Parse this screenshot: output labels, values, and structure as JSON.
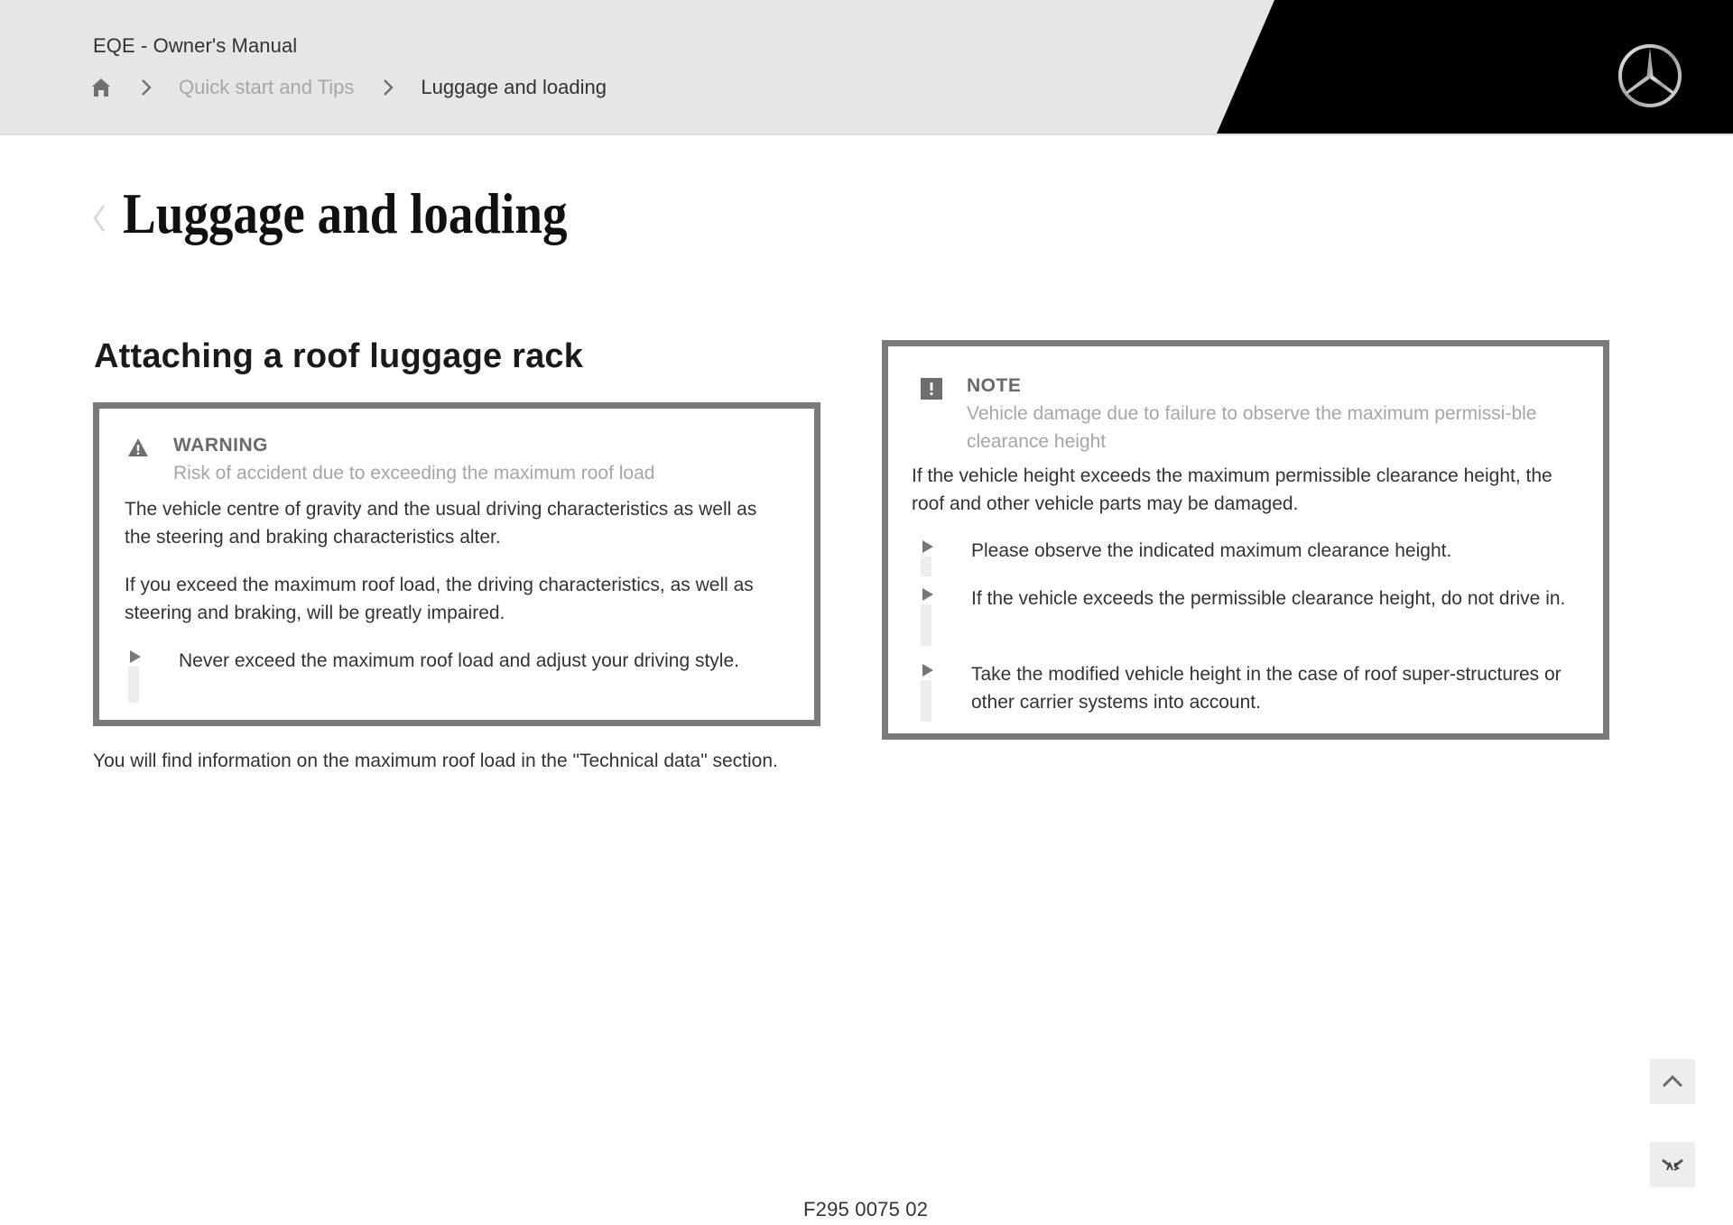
{
  "header": {
    "manual_title": "EQE - Owner's Manual",
    "breadcrumb": {
      "home_icon": "home-icon",
      "separator_icon": "chevron-right-icon",
      "items": [
        {
          "label": "Quick start and Tips"
        },
        {
          "label": "Luggage and loading"
        }
      ]
    },
    "logo": "mercedes-star-logo"
  },
  "page": {
    "back_icon": "chevron-left-icon",
    "title": "Luggage and loading"
  },
  "section": {
    "heading": "Attaching a roof luggage rack",
    "warning": {
      "icon": "warning-triangle-icon",
      "label": "WARNING",
      "subtitle": "Risk of accident due to exceeding the maximum roof load",
      "paragraphs": [
        "The vehicle centre of gravity and the usual driving characteristics as well as the steering and braking characteristics alter.",
        "If you exceed the maximum roof load, the driving characteristics, as well as steering and braking, will be greatly impaired."
      ],
      "bullets": [
        "Never exceed the maximum roof load and adjust your driving style."
      ]
    },
    "after_text": "You will find information on the maximum roof load in the \"Technical data\" section."
  },
  "note": {
    "icon": "exclamation-square-icon",
    "label": "NOTE",
    "subtitle": "Vehicle damage due to failure to observe the maximum permissi-ble clearance height",
    "paragraph": "If the vehicle height exceeds the maximum permissible clearance height, the roof and other vehicle parts may be damaged.",
    "bullets": [
      "Please observe the indicated maximum clearance height.",
      "If the vehicle exceeds the permissible clearance height, do not drive in.",
      "Take the modified vehicle height in the case of roof super-structures or other carrier systems into account."
    ]
  },
  "side_buttons": {
    "scroll_top_icon": "chevron-up-icon",
    "feedback_icon": "feedback-icon"
  },
  "footer": {
    "document_code": "F295 0075 02"
  }
}
